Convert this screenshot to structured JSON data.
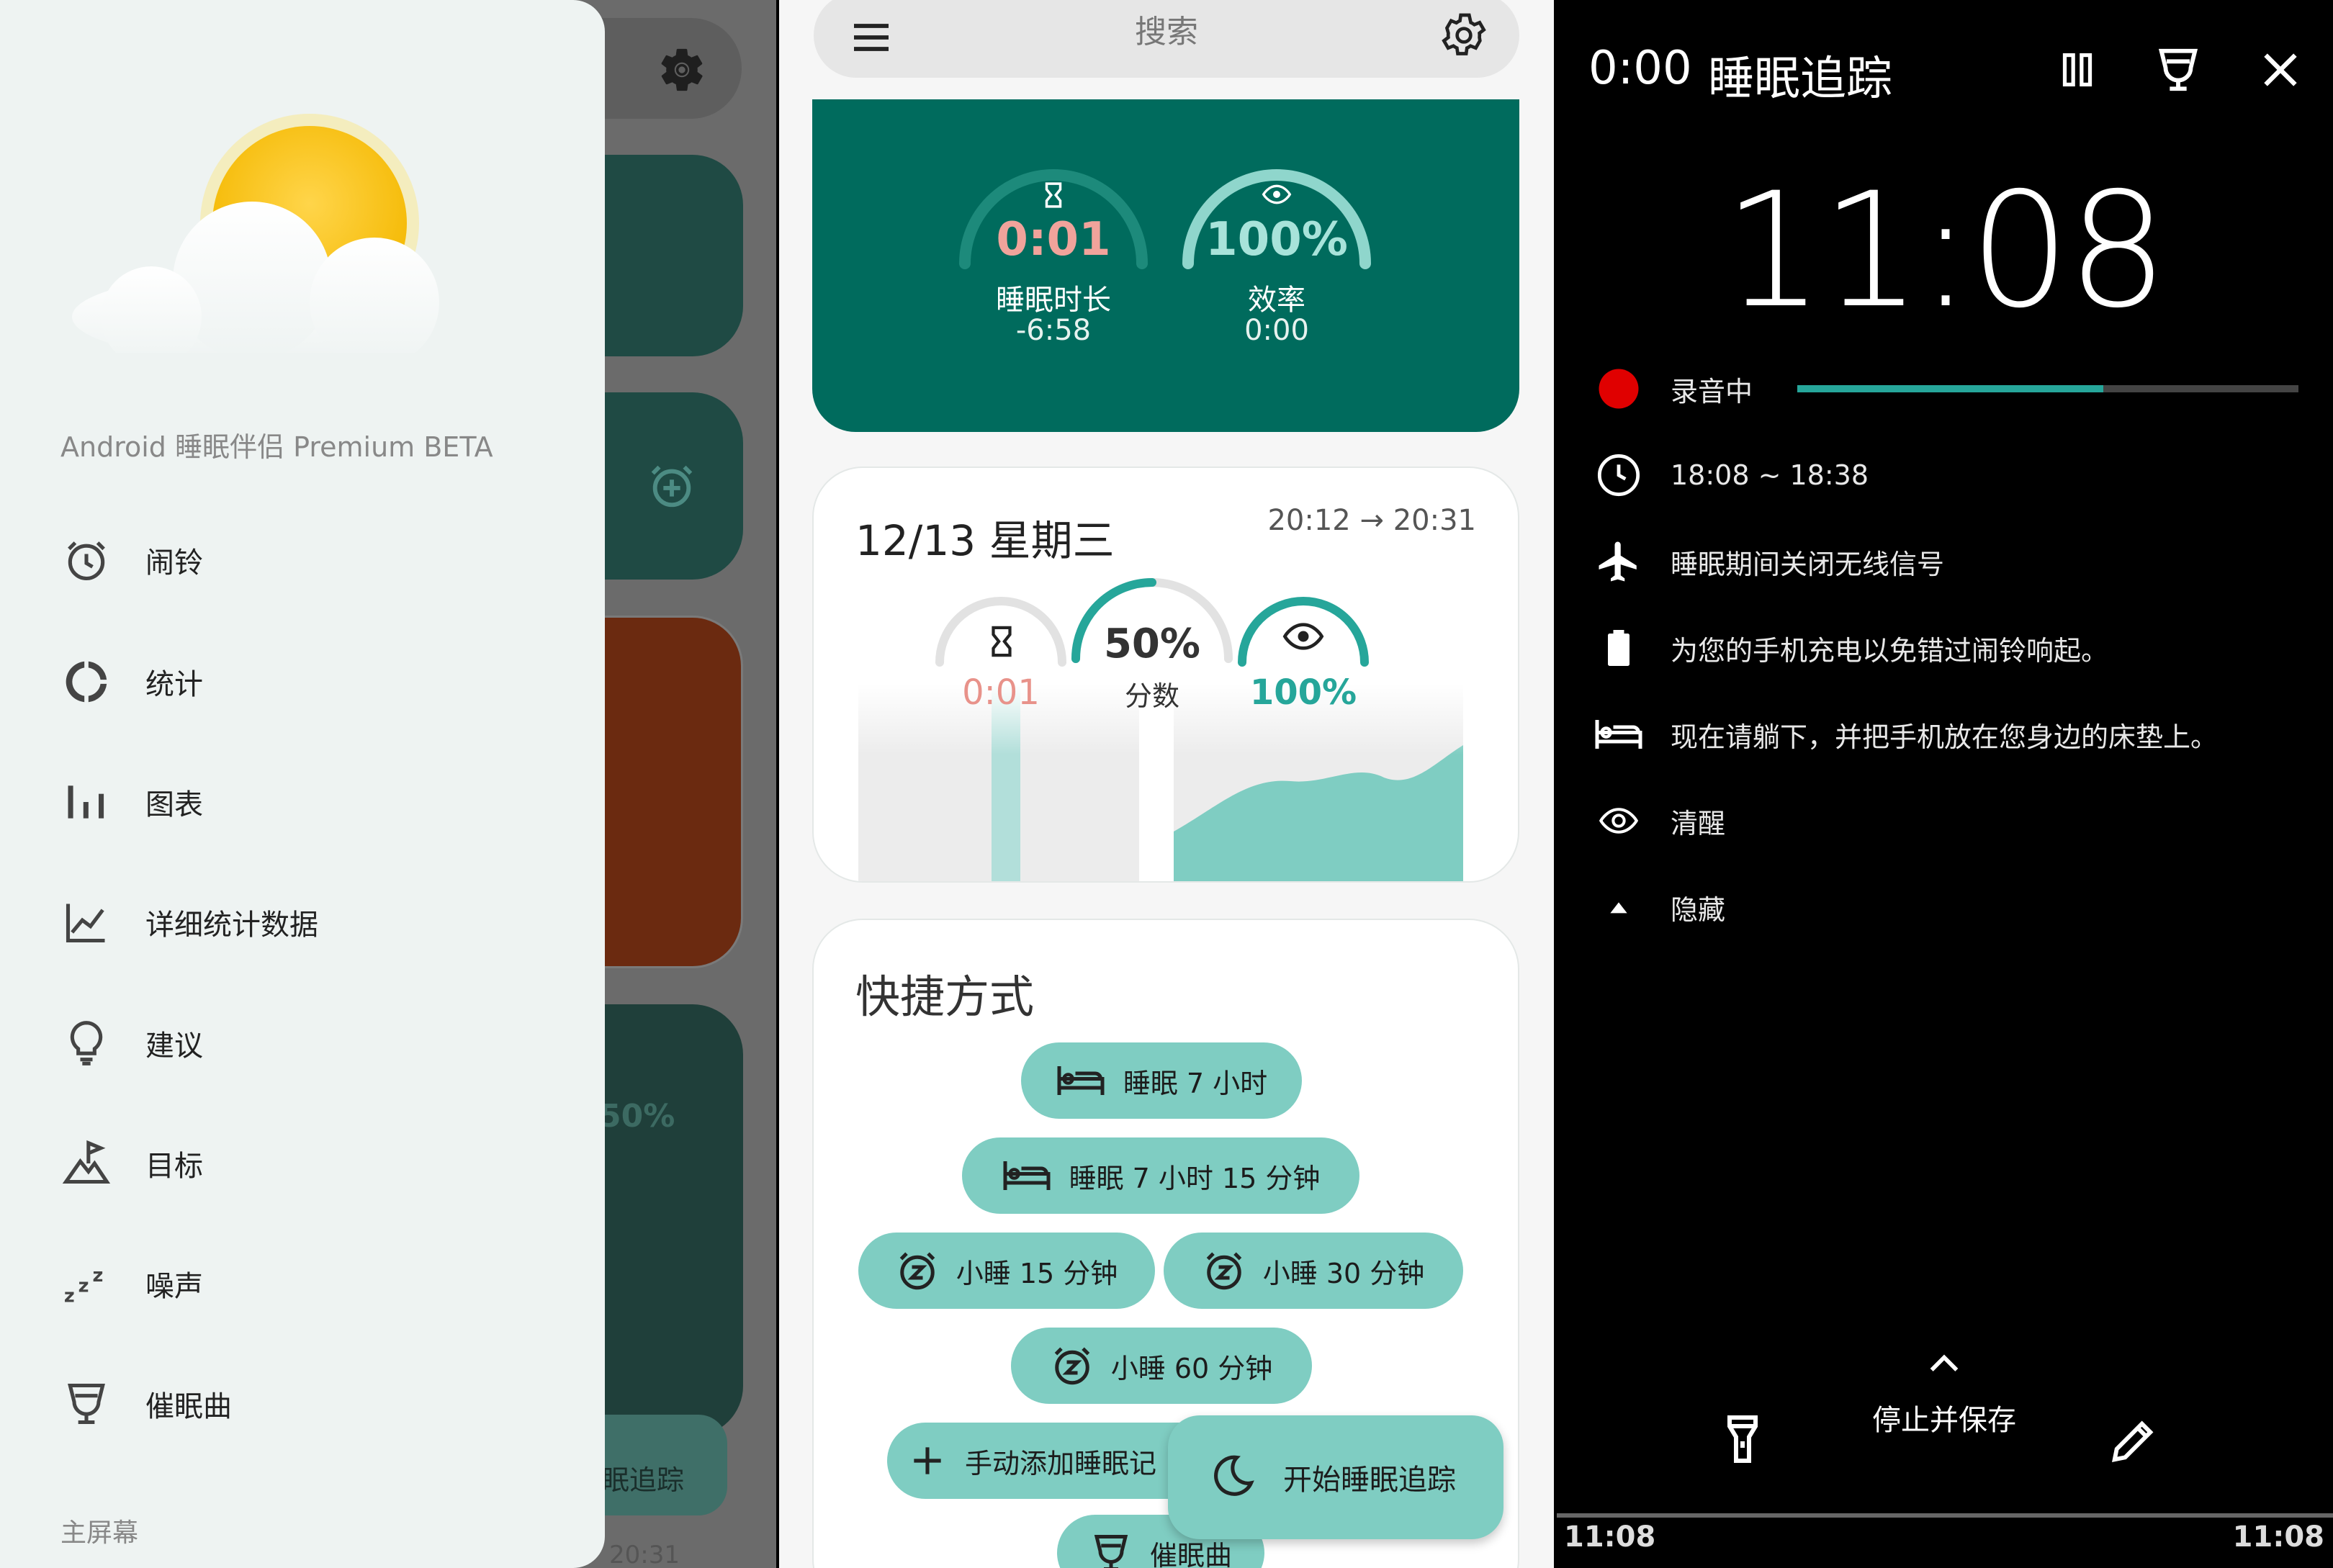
{
  "drawer": {
    "app_name": "Android 睡眠伴侣 Premium BETA",
    "items": [
      {
        "label": "闹铃",
        "icon": "alarm-icon"
      },
      {
        "label": "统计",
        "icon": "stats-ring-icon"
      },
      {
        "label": "图表",
        "icon": "bar-chart-icon"
      },
      {
        "label": "详细统计数据",
        "icon": "line-chart-icon"
      },
      {
        "label": "建议",
        "icon": "lightbulb-icon"
      },
      {
        "label": "目标",
        "icon": "goal-flag-icon"
      },
      {
        "label": "噪声",
        "icon": "zzz-icon"
      },
      {
        "label": "催眠曲",
        "icon": "lullaby-icon"
      }
    ],
    "section_label": "主屏幕"
  },
  "behind": {
    "score": "50%",
    "track_label": "眠追踪",
    "time": "20:31"
  },
  "main": {
    "search_placeholder": "搜索",
    "hero": {
      "duration_value": "0:01",
      "duration_label": "睡眠时长",
      "duration_delta": "-6:58",
      "efficiency_value": "100%",
      "efficiency_label": "效率",
      "efficiency_sub": "0:00"
    },
    "record": {
      "date": "12/13 星期三",
      "range_start": "20:12",
      "range_arrow": "→",
      "range_end": "20:31",
      "duration": "0:01",
      "score": "50%",
      "score_label": "分数",
      "efficiency": "100%"
    },
    "shortcuts": {
      "title": "快捷方式",
      "chips": [
        {
          "label": "睡眠 7 小时",
          "icon": "bed-icon"
        },
        {
          "label": "睡眠 7 小时 15 分钟",
          "icon": "bed-icon"
        },
        {
          "label": "小睡 15 分钟",
          "icon": "nap-alarm-icon"
        },
        {
          "label": "小睡 30 分钟",
          "icon": "nap-alarm-icon"
        },
        {
          "label": "小睡 60 分钟",
          "icon": "nap-alarm-icon"
        },
        {
          "label": "手动添加睡眠记",
          "icon": "plus-icon"
        },
        {
          "label": "催眠曲",
          "icon": "lullaby-icon"
        }
      ]
    },
    "fab_label": "开始睡眠追踪"
  },
  "tracking": {
    "elapsed": "0:00",
    "title": "睡眠追踪",
    "clock": "11:08",
    "recording_label": "录音中",
    "recording_level": 0.61,
    "rows": [
      {
        "label": "18:08 ~ 18:38",
        "icon": "clock-icon"
      },
      {
        "label": "睡眠期间关闭无线信号",
        "icon": "airplane-icon"
      },
      {
        "label": "为您的手机充电以免错过闹铃响起。",
        "icon": "battery-icon"
      },
      {
        "label": "现在请躺下，并把手机放在您身边的床垫上。",
        "icon": "bed-icon"
      },
      {
        "label": "清醒",
        "icon": "eye-icon"
      },
      {
        "label": "隐藏",
        "icon": "triangle-up-icon"
      }
    ],
    "stop_save": "停止并保存",
    "status_left": "11:08",
    "status_right": "11:08"
  },
  "colors": {
    "teal_dark": "#006b5d",
    "teal_light": "#7fcdc2",
    "accent_teal": "#26a69a",
    "salmon": "#e8928a",
    "record_red": "#e00000"
  }
}
